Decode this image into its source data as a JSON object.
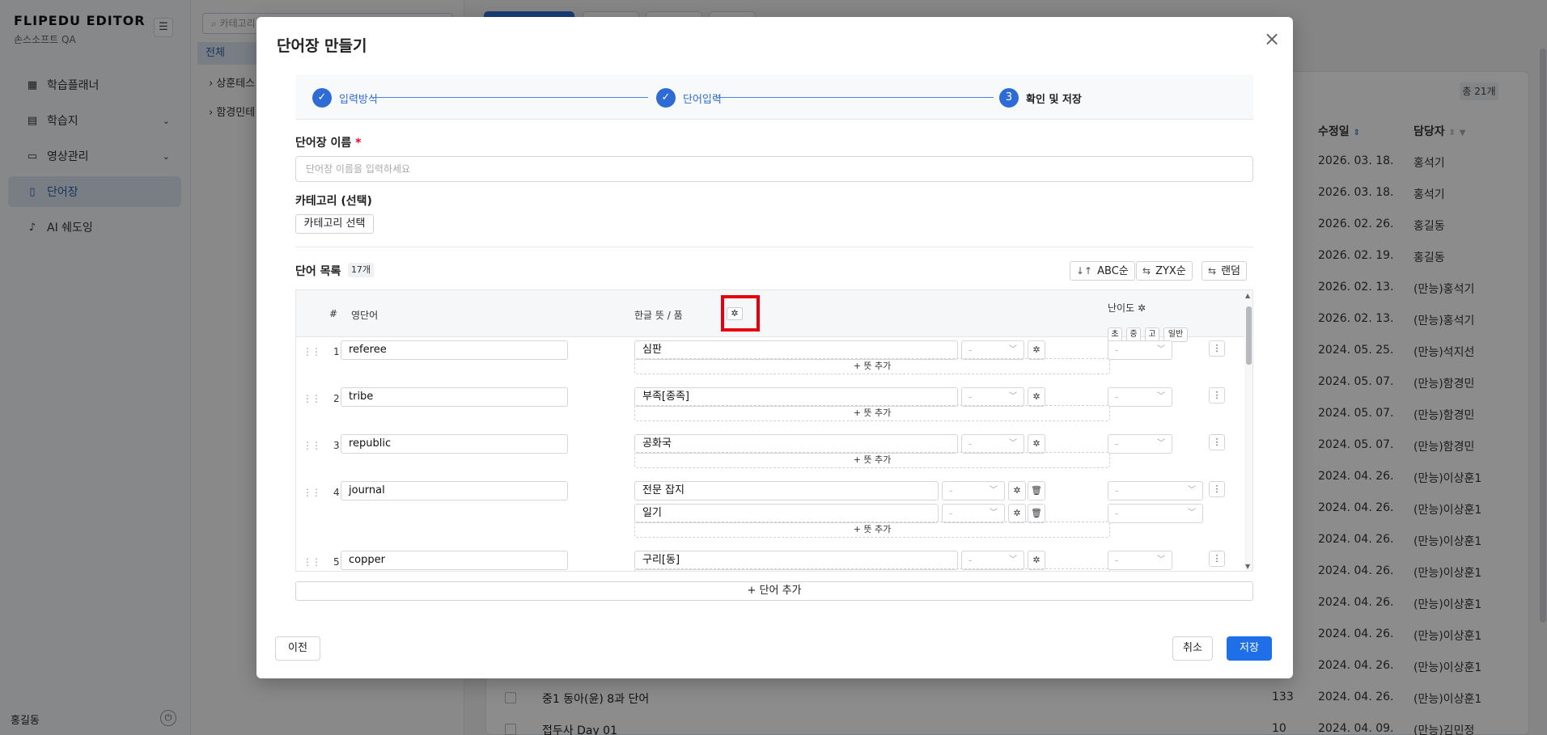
{
  "app": {
    "brand": "FLIPEDU EDITOR",
    "org": "손스소프트 QA",
    "user": "홍길동"
  },
  "sidebar": {
    "items": [
      {
        "label": "학습플래너",
        "icon": "calendar-icon",
        "active": false
      },
      {
        "label": "학습지",
        "icon": "document-icon",
        "active": false,
        "chevron": true
      },
      {
        "label": "영상관리",
        "icon": "video-icon",
        "active": false,
        "chevron": true
      },
      {
        "label": "단어장",
        "icon": "book-icon",
        "active": true
      },
      {
        "label": "AI 쉐도잉",
        "icon": "mic-icon",
        "active": false
      }
    ]
  },
  "category_panel": {
    "search_placeholder": "카테고리",
    "all_label": "전체",
    "items": [
      "상훈테스",
      "함경민테"
    ]
  },
  "background_list": {
    "total": "총 21개",
    "headers": {
      "updated": "수정일",
      "owner": "담당자"
    },
    "rows": [
      {
        "date": "2026. 03. 18.",
        "owner": "홍석기"
      },
      {
        "date": "2026. 03. 18.",
        "owner": "홍석기"
      },
      {
        "date": "2026. 02. 26.",
        "owner": "홍길동"
      },
      {
        "date": "2026. 02. 19.",
        "owner": "홍길동"
      },
      {
        "date": "2026. 02. 13.",
        "owner": "(만능)홍석기"
      },
      {
        "date": "2026. 02. 13.",
        "owner": "(만능)홍석기"
      },
      {
        "date": "2024. 05. 25.",
        "owner": "(만능)석지선"
      },
      {
        "date": "2024. 05. 07.",
        "owner": "(만능)함경민"
      },
      {
        "date": "2024. 05. 07.",
        "owner": "(만능)함경민"
      },
      {
        "date": "2024. 05. 07.",
        "owner": "(만능)함경민"
      },
      {
        "date": "2024. 04. 26.",
        "owner": "(만능)이상훈1"
      },
      {
        "date": "2024. 04. 26.",
        "owner": "(만능)이상훈1"
      },
      {
        "date": "2024. 04. 26.",
        "owner": "(만능)이상훈1"
      },
      {
        "date": "2024. 04. 26.",
        "owner": "(만능)이상훈1"
      },
      {
        "date": "2024. 04. 26.",
        "owner": "(만능)이상훈1"
      },
      {
        "date": "2024. 04. 26.",
        "owner": "(만능)이상훈1"
      },
      {
        "date": "2024. 04. 26.",
        "owner": "(만능)이상훈1"
      },
      {
        "name": "중1 동아(윤) 8과 단어",
        "count": "133",
        "date": "2024. 04. 26.",
        "owner": "(만능)이상훈1"
      },
      {
        "name": "접두사 Day 01",
        "count": "10",
        "date": "2024. 04. 09.",
        "owner": "(만능)김민정"
      }
    ]
  },
  "modal": {
    "title": "단어장 만들기",
    "close_icon": "close-icon",
    "steps": [
      {
        "label": "입력방식",
        "state": "done"
      },
      {
        "label": "단어입력",
        "state": "done"
      },
      {
        "number": "3",
        "label": "확인 및 저장",
        "state": "current"
      }
    ],
    "name_label": "단어장 이름",
    "required_mark": "*",
    "name_placeholder": "단어장 이름을 입력하세요",
    "category_label": "카테고리 (선택)",
    "category_button": "카테고리 선택",
    "word_list_label": "단어 목록",
    "word_count": "17개",
    "sort_buttons": [
      {
        "label": "ABC순",
        "icon": "sort-asc-icon"
      },
      {
        "label": "ZYX순",
        "icon": "sort-desc-icon"
      },
      {
        "label": "랜덤",
        "icon": "shuffle-icon"
      }
    ],
    "table_headers": {
      "num": "#",
      "english": "영단어",
      "meaning": "한글 뜻 / 품",
      "meaning_tail": "",
      "difficulty": "난이도",
      "difficulty_chips": [
        "초",
        "중",
        "고",
        "일반"
      ]
    },
    "add_meaning_label": "+ 뜻 추가",
    "dash_placeholder": "-",
    "words": [
      {
        "num": "1",
        "english": "referee",
        "meanings": [
          "심판"
        ]
      },
      {
        "num": "2",
        "english": "tribe",
        "meanings": [
          "부족[종족]"
        ]
      },
      {
        "num": "3",
        "english": "republic",
        "meanings": [
          "공화국"
        ]
      },
      {
        "num": "4",
        "english": "journal",
        "meanings": [
          "전문 잡지",
          "일기"
        ]
      },
      {
        "num": "5",
        "english": "copper",
        "meanings": [
          "구리[동]"
        ]
      }
    ],
    "add_word_button": "+ 단어 추가",
    "prev_button": "이전",
    "cancel_button": "취소",
    "save_button": "저장"
  },
  "colors": {
    "accent": "#2e6bd4",
    "save": "#1f6fe8",
    "highlight": "#e6000e"
  }
}
